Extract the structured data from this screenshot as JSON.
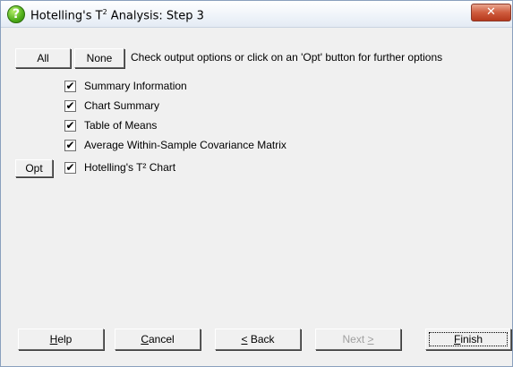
{
  "window": {
    "title_prefix": "Hotelling's T",
    "title_sup": "2",
    "title_suffix": " Analysis: Step 3",
    "close_glyph": "✕"
  },
  "toolbar": {
    "all_label": "All",
    "none_label": "None",
    "hint": "Check output options or click on an 'Opt' button for further options"
  },
  "options": [
    {
      "label": "Summary Information",
      "checked": true
    },
    {
      "label": "Chart Summary",
      "checked": true
    },
    {
      "label": "Table of Means",
      "checked": true
    },
    {
      "label": "Average Within-Sample Covariance Matrix",
      "checked": true
    },
    {
      "label": "Hotelling's T² Chart",
      "checked": true
    }
  ],
  "opt_button": {
    "label": "Opt"
  },
  "buttons": {
    "help": {
      "mnemonic": "H",
      "rest": "elp"
    },
    "cancel": {
      "mnemonic": "C",
      "rest": "ancel"
    },
    "back": {
      "mnemonic": "<",
      "rest": " Back"
    },
    "next": {
      "text": "Next ",
      "mnemonic": ">"
    },
    "finish": {
      "mnemonic": "F",
      "rest": "inish"
    }
  },
  "check_glyph": "✔",
  "colors": {
    "title_bar": "#e4ebf4",
    "close_red": "#cf5c3e",
    "help_icon_green": "#4fae1a",
    "disabled_text": "#a0a0a0"
  }
}
